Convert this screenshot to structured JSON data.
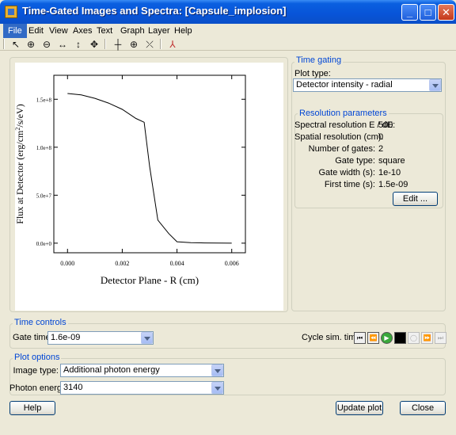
{
  "window": {
    "title": "Time-Gated Images and Spectra: [Capsule_implosion]",
    "min_glyph": "_",
    "max_glyph": "□",
    "close_glyph": "✕"
  },
  "menu": {
    "items": [
      "File",
      "Edit",
      "View",
      "Axes",
      "Text",
      "Graph",
      "Layer",
      "Help"
    ],
    "active": "File"
  },
  "toolbar": {
    "icons": [
      "pointer-icon",
      "zoom-in-icon",
      "zoom-out-icon",
      "pan-horizontal-icon",
      "pan-vertical-icon",
      "pan-icon",
      "crosshair-icon",
      "data-reader-icon",
      "marker-icon",
      "axes-icon"
    ],
    "glyphs": [
      "↖",
      "⊕",
      "⊖",
      "↔",
      "↕",
      "✥",
      "┼",
      "⊕",
      "⤫",
      "⅄"
    ]
  },
  "plot": {
    "ylabel_html": "Flux at Detector (erg/cm²/s/eV)",
    "xlabel": "Detector Plane - R (cm)"
  },
  "chart_data": {
    "type": "line",
    "xlabel": "Detector Plane - R (cm)",
    "ylabel": "Flux at Detector (erg/cm2/s/eV)",
    "xlim": [
      -0.0005,
      0.0065
    ],
    "ylim": [
      -10000000.0,
      175000000.0
    ],
    "xticks": [
      0,
      0.002,
      0.004,
      0.006
    ],
    "xtick_labels": [
      "0.000",
      "0.002",
      "0.004",
      "0.006"
    ],
    "yticks": [
      0,
      50000000.0,
      100000000.0,
      150000000.0
    ],
    "ytick_labels": [
      "0.0e+0",
      "5.0e+7",
      "1.0e+8",
      "1.5e+8"
    ],
    "grid": false,
    "series": [
      {
        "x": [
          0,
          0.0005,
          0.001,
          0.0015,
          0.002,
          0.0025,
          0.0028,
          0.003,
          0.0033,
          0.0037,
          0.004,
          0.0045,
          0.005,
          0.0055,
          0.006
        ],
        "y": [
          156000000.0,
          154500000.0,
          151000000.0,
          146000000.0,
          139500000.0,
          130000000.0,
          126000000.0,
          80000000.0,
          24000000.0,
          10000000.0,
          1500000.0,
          500000.0,
          200000.0,
          50000.0,
          0
        ]
      }
    ]
  },
  "time_gating": {
    "label": "Time gating",
    "plot_type_label": "Plot type:",
    "plot_type_value": "Detector intensity - radial",
    "resolution": {
      "label": "Resolution parameters",
      "rows": [
        {
          "label": "Spectral resolution E / dE:",
          "value": "500"
        },
        {
          "label": "Spatial resolution (cm):",
          "value": "0"
        },
        {
          "label": "Number of gates:",
          "value": "2"
        },
        {
          "label": "Gate type:",
          "value": "square"
        },
        {
          "label": "Gate width (s):",
          "value": "1e-10"
        },
        {
          "label": "First time (s):",
          "value": "1.5e-09"
        }
      ],
      "edit_label": "Edit ..."
    }
  },
  "time_controls": {
    "label": "Time controls",
    "gate_time_label": "Gate time:",
    "gate_time_value": "1.6e-09",
    "cycle_label": "Cycle sim. time:"
  },
  "plot_options": {
    "label": "Plot options",
    "image_type_label": "Image type:",
    "image_type_value": "Additional photon energy",
    "photon_energy_label": "Photon energy",
    "photon_energy_value": "3140"
  },
  "buttons": {
    "help": "Help",
    "update_plot": "Update plot",
    "close": "Close"
  }
}
